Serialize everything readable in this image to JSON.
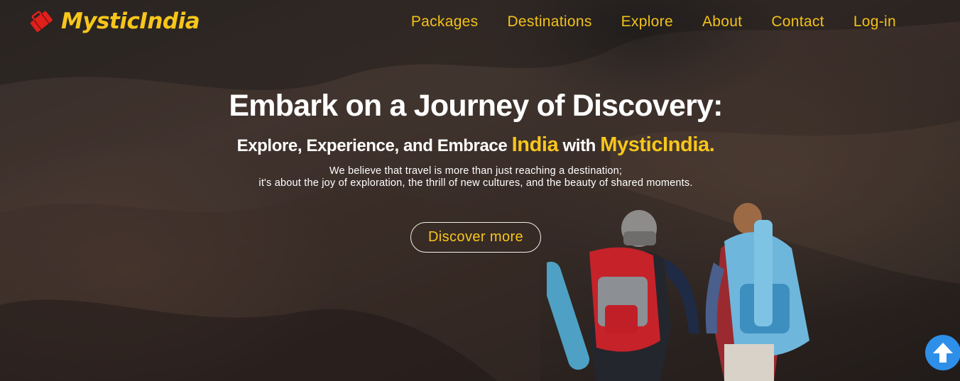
{
  "brand": {
    "name": "MysticIndia"
  },
  "nav": {
    "items": [
      "Packages",
      "Destinations",
      "Explore",
      "About",
      "Contact",
      "Log-in"
    ]
  },
  "hero": {
    "headline": "Embark on a Journey of Discovery:",
    "subline_prefix": "Explore, Experience, and Embrace ",
    "subline_highlight_1": "India",
    "subline_middle": " with ",
    "subline_highlight_2": "MysticIndia.",
    "paragraph_line_1": "We believe that travel is more than just reaching a destination;",
    "paragraph_line_2": "it's about the joy of exploration, the thrill of new cultures, and the beauty of shared moments.",
    "cta_label": "Discover more"
  },
  "icons": {
    "logo": "suitcase-icon",
    "scroll_top": "arrow-up-icon"
  },
  "colors": {
    "accent": "#f7c61b",
    "logo_red": "#e0201b",
    "scroll_button": "#2e8fe8",
    "text": "#ffffff"
  }
}
